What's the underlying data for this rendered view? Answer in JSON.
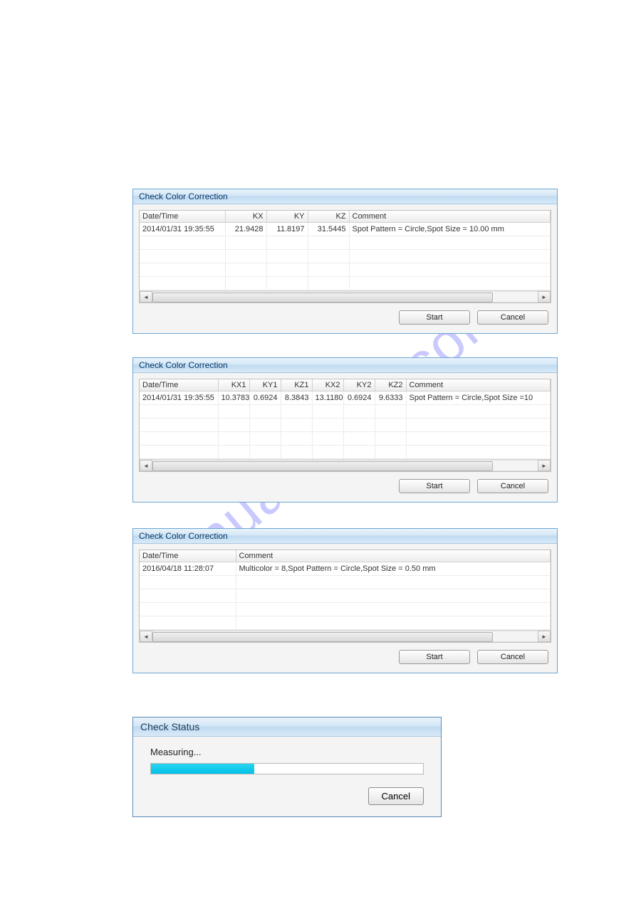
{
  "watermark": "manualshive.com",
  "dialog1": {
    "title": "Check Color Correction",
    "headers": [
      "Date/Time",
      "KX",
      "KY",
      "KZ",
      "Comment"
    ],
    "row": {
      "datetime": "2014/01/31 19:35:55",
      "kx": "21.9428",
      "ky": "11.8197",
      "kz": "31.5445",
      "comment": "Spot Pattern = Circle,Spot Size = 10.00 mm"
    },
    "start": "Start",
    "cancel": "Cancel"
  },
  "dialog2": {
    "title": "Check Color Correction",
    "headers": [
      "Date/Time",
      "KX1",
      "KY1",
      "KZ1",
      "KX2",
      "KY2",
      "KZ2",
      "Comment"
    ],
    "row": {
      "datetime": "2014/01/31 19:35:55",
      "kx1": "10.3783",
      "ky1": "0.6924",
      "kz1": "8.3843",
      "kx2": "13.1180",
      "ky2": "0.6924",
      "kz2": "9.6333",
      "comment": "Spot Pattern = Circle,Spot Size =10"
    },
    "start": "Start",
    "cancel": "Cancel"
  },
  "dialog3": {
    "title": "Check Color Correction",
    "headers": [
      "Date/Time",
      "Comment"
    ],
    "row": {
      "datetime": "2016/04/18 11:28:07",
      "comment": "Multicolor = 8,Spot Pattern = Circle,Spot Size = 0.50 mm"
    },
    "start": "Start",
    "cancel": "Cancel"
  },
  "status": {
    "title": "Check Status",
    "label": "Measuring...",
    "progress_pct": 38,
    "cancel": "Cancel"
  }
}
